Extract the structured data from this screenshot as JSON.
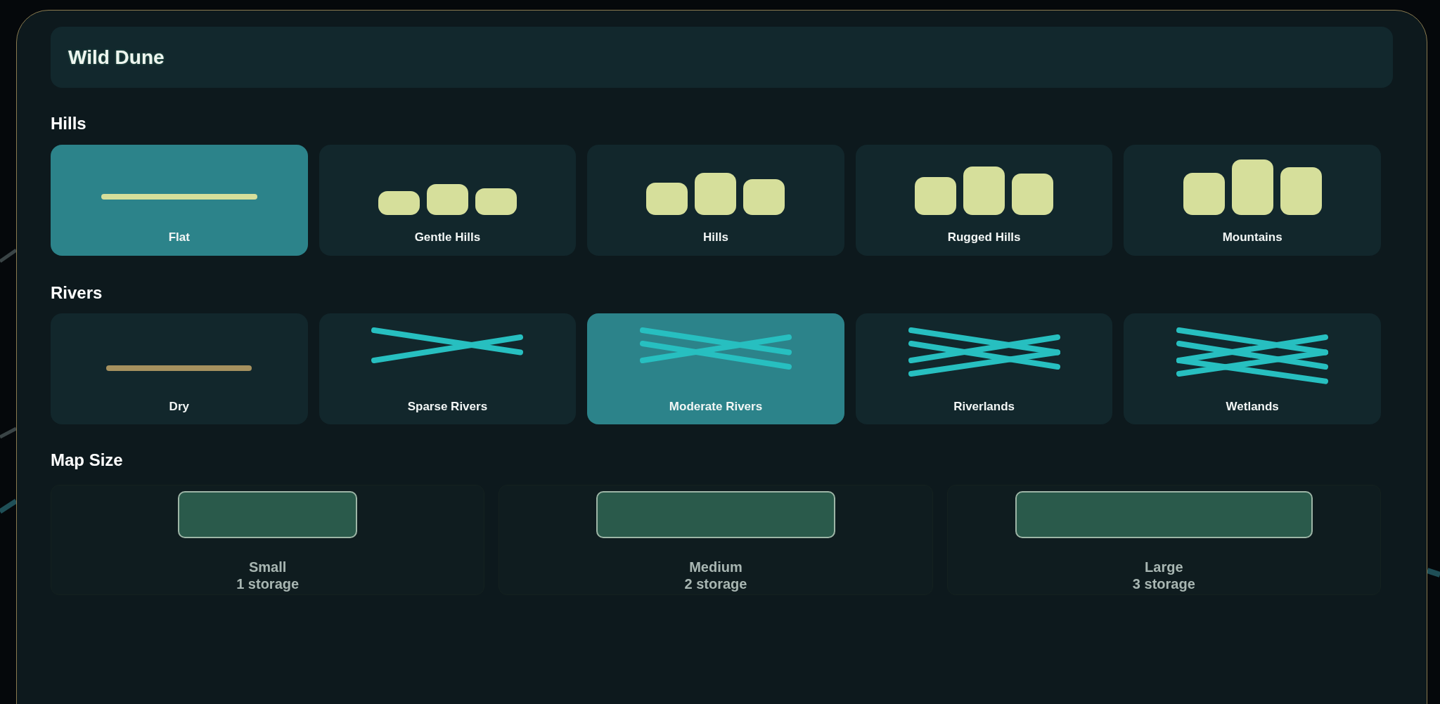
{
  "title": "Wild Dune",
  "hills": {
    "heading": "Hills",
    "items": [
      {
        "label": "Flat",
        "kind": "flat",
        "selected": true
      },
      {
        "label": "Gentle Hills",
        "kind": "gentle",
        "selected": false
      },
      {
        "label": "Hills",
        "kind": "hills",
        "selected": false
      },
      {
        "label": "Rugged Hills",
        "kind": "rugged",
        "selected": false
      },
      {
        "label": "Mountains",
        "kind": "mountains",
        "selected": false
      }
    ]
  },
  "rivers": {
    "heading": "Rivers",
    "items": [
      {
        "label": "Dry",
        "kind": "dry",
        "selected": false
      },
      {
        "label": "Sparse Rivers",
        "kind": "sparse",
        "selected": false
      },
      {
        "label": "Moderate Rivers",
        "kind": "moderate",
        "selected": true
      },
      {
        "label": "Riverlands",
        "kind": "riverlands",
        "selected": false
      },
      {
        "label": "Wetlands",
        "kind": "wetlands",
        "selected": false
      }
    ]
  },
  "map_size": {
    "heading": "Map Size",
    "items": [
      {
        "name": "Small",
        "storage": "1 storage",
        "kind": "small",
        "selected": false
      },
      {
        "name": "Medium",
        "storage": "2 storage",
        "kind": "medium",
        "selected": false
      },
      {
        "name": "Large",
        "storage": "3 storage",
        "kind": "large",
        "selected": false
      }
    ]
  }
}
